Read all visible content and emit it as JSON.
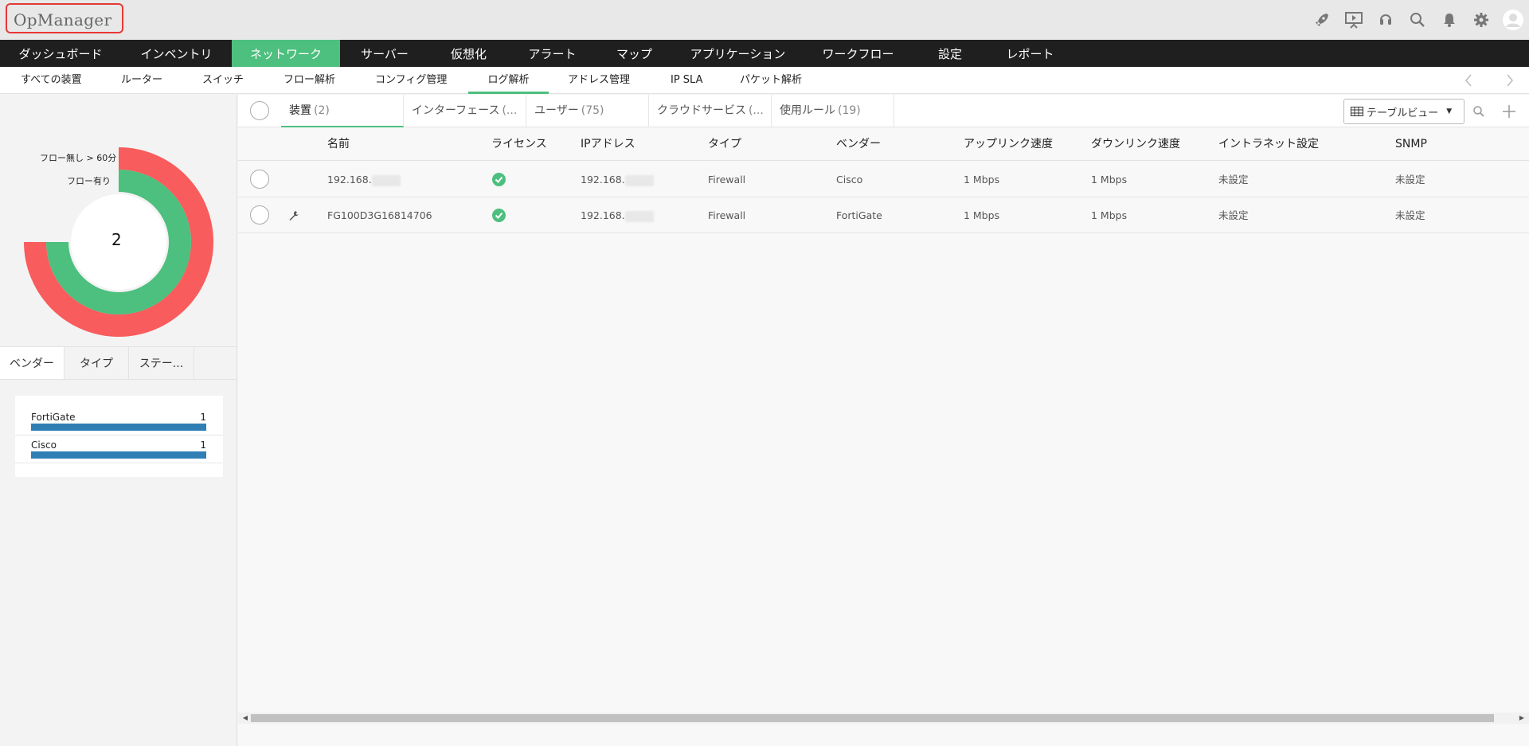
{
  "app": {
    "title": "OpManager"
  },
  "topbar": {
    "icons": [
      "rocket-icon",
      "presentation-icon",
      "headset-icon",
      "search-icon",
      "bell-icon",
      "gear-icon",
      "user-avatar-icon"
    ]
  },
  "main_nav": [
    {
      "label": "ダッシュボード"
    },
    {
      "label": "インベントリ"
    },
    {
      "label": "ネットワーク",
      "active": true
    },
    {
      "label": "サーバー"
    },
    {
      "label": "仮想化"
    },
    {
      "label": "アラート"
    },
    {
      "label": "マップ"
    },
    {
      "label": "アプリケーション"
    },
    {
      "label": "ワークフロー"
    },
    {
      "label": "設定"
    },
    {
      "label": "レポート"
    }
  ],
  "sub_nav": [
    {
      "label": "すべての装置"
    },
    {
      "label": "ルーター"
    },
    {
      "label": "スイッチ"
    },
    {
      "label": "フロー解析"
    },
    {
      "label": "コンフィグ管理"
    },
    {
      "label": "ログ解析",
      "active": true
    },
    {
      "label": "アドレス管理"
    },
    {
      "label": "IP SLA"
    },
    {
      "label": "パケット解析"
    }
  ],
  "donut": {
    "center_value": "2",
    "outer_label": "フロー無し > 60分",
    "inner_label": "フロー有り",
    "outer_fraction": 0.75,
    "inner_fraction": 0.75,
    "outer_color": "#f85c5c",
    "inner_color": "#4dbf7e"
  },
  "left_tabs": [
    {
      "label": "ベンダー",
      "active": true
    },
    {
      "label": "タイプ"
    },
    {
      "label": "ステー..."
    }
  ],
  "vendor_list": [
    {
      "name": "FortiGate",
      "count": "1",
      "fraction": 1.0
    },
    {
      "name": "Cisco",
      "count": "1",
      "fraction": 1.0
    }
  ],
  "tabs": [
    {
      "label": "装置",
      "count": "(2)",
      "active": true
    },
    {
      "label": "インターフェース",
      "count": "(..."
    },
    {
      "label": "ユーザー",
      "count": "(75)"
    },
    {
      "label": "クラウドサービス",
      "count": "(..."
    },
    {
      "label": "使用ルール",
      "count": "(19)"
    }
  ],
  "view_button": {
    "label": "テーブルビュー"
  },
  "table": {
    "columns": [
      "名前",
      "ライセンス",
      "IPアドレス",
      "タイプ",
      "ベンダー",
      "アップリンク速度",
      "ダウンリンク速度",
      "イントラネット設定",
      "SNMP"
    ],
    "rows": [
      {
        "name": "192.168.",
        "license": "ok",
        "ip": "192.168.",
        "type": "Firewall",
        "vendor": "Cisco",
        "uplink": "1 Mbps",
        "downlink": "1 Mbps",
        "intranet": "未設定",
        "snmp": "未設定",
        "wrench": false
      },
      {
        "name": "FG100D3G16814706",
        "license": "ok",
        "ip": "192.168.",
        "type": "Firewall",
        "vendor": "FortiGate",
        "uplink": "1 Mbps",
        "downlink": "1 Mbps",
        "intranet": "未設定",
        "snmp": "未設定",
        "wrench": true
      }
    ]
  }
}
